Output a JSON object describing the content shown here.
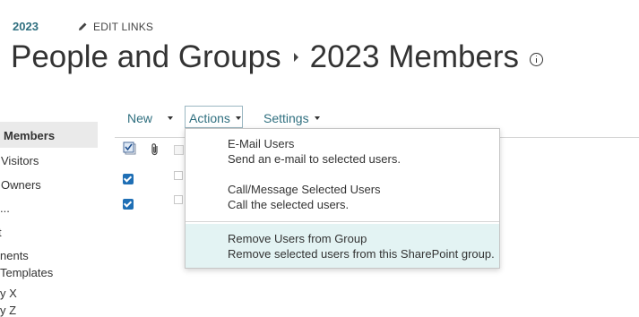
{
  "breadcrumb": {
    "site": "2023",
    "edit_links": "EDIT LINKS"
  },
  "title": {
    "part1": "People and Groups",
    "part2": "2023 Members"
  },
  "nav": {
    "items": [
      {
        "label": "Members",
        "active": true
      },
      {
        "label": "Visitors"
      },
      {
        "label": "Owners"
      },
      {
        "label": "..."
      },
      {
        "label": "t"
      },
      {
        "label": "nents"
      },
      {
        "label": "Templates"
      },
      {
        "label": "y X"
      },
      {
        "label": "y Z"
      }
    ]
  },
  "toolbar": {
    "new_label": "New",
    "actions_label": "Actions",
    "settings_label": "Settings"
  },
  "menu": {
    "items": [
      {
        "title": "E-Mail Users",
        "desc": "Send an e-mail to selected users."
      },
      {
        "title": "Call/Message Selected Users",
        "desc": "Call the selected users."
      },
      {
        "title": "Remove Users from Group",
        "desc": "Remove selected users from this SharePoint group."
      }
    ]
  },
  "colors": {
    "accent": "#2f6f7f",
    "checkbox": "#1f6fb5",
    "menu_hover": "#e3f3f3"
  },
  "icons": [
    "pencil-icon",
    "info-icon",
    "select-all-icon",
    "attachment-icon",
    "caret-down-icon"
  ]
}
